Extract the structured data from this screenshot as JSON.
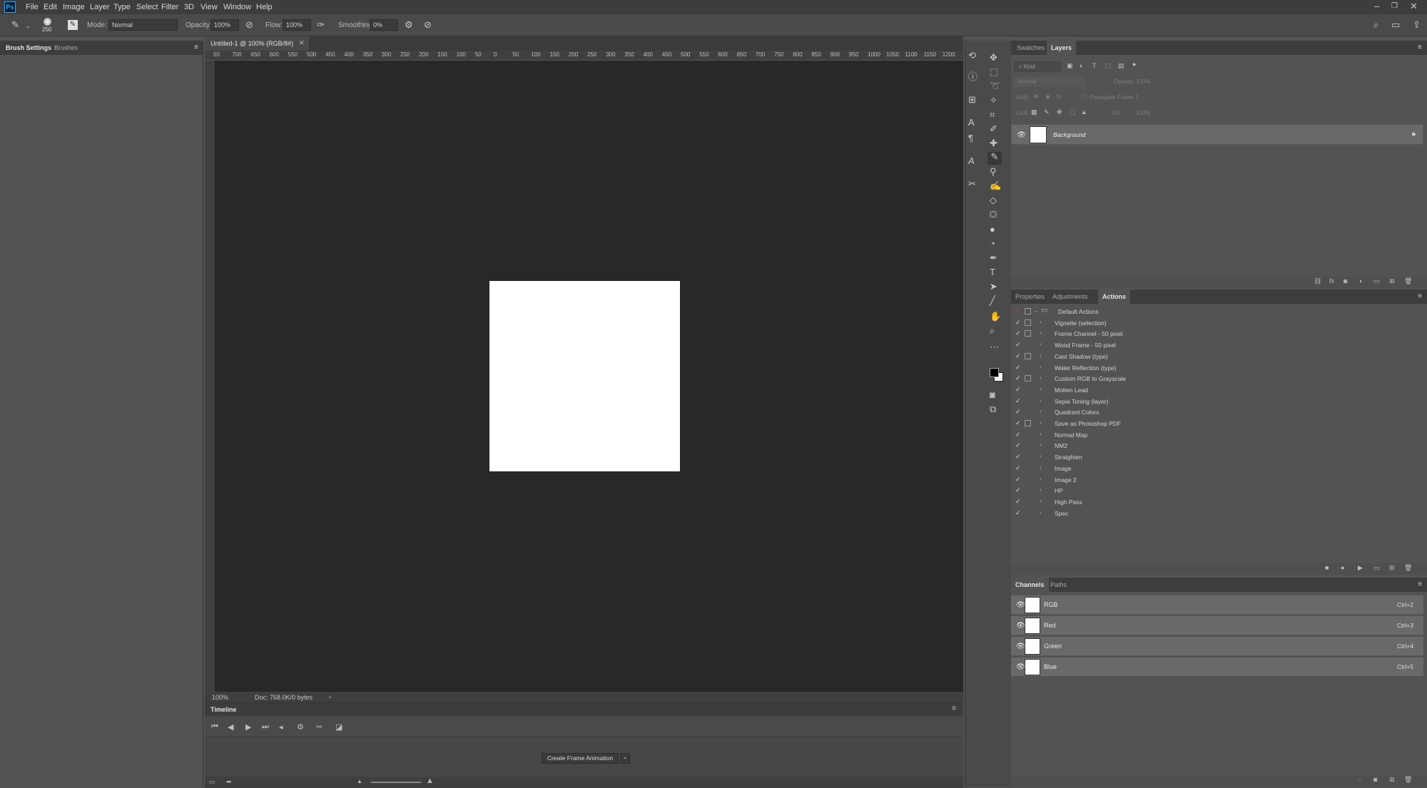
{
  "menu": [
    "File",
    "Edit",
    "Image",
    "Layer",
    "Type",
    "Select",
    "Filter",
    "3D",
    "View",
    "Window",
    "Help"
  ],
  "options": {
    "brush_size": "250",
    "mode_label": "Mode:",
    "mode_value": "Normal",
    "opacity_label": "Opacity:",
    "opacity_value": "100%",
    "flow_label": "Flow:",
    "flow_value": "100%",
    "smoothing_label": "Smoothing:",
    "smoothing_value": "0%"
  },
  "left_panel": {
    "tabs": [
      "Brush Settings",
      "Brushes"
    ]
  },
  "document": {
    "tab_title": "Untitled-1 @ 100% (RGB/8#)",
    "zoom": "100%",
    "doc_info": "Doc: 768.0K/0 bytes",
    "ruler_ticks": [
      "50",
      "700",
      "650",
      "600",
      "550",
      "500",
      "450",
      "400",
      "350",
      "300",
      "250",
      "200",
      "150",
      "100",
      "50",
      "0",
      "50",
      "100",
      "150",
      "200",
      "250",
      "300",
      "350",
      "400",
      "450",
      "500",
      "550",
      "600",
      "650",
      "700",
      "750",
      "800",
      "850",
      "900",
      "950",
      "1000",
      "1050",
      "1100",
      "1150",
      "1200"
    ]
  },
  "timeline": {
    "title": "Timeline",
    "create_button": "Create Frame Animation"
  },
  "layers_panel": {
    "tabs": [
      "Swatches",
      "Layers"
    ],
    "kind_placeholder": "Kind",
    "blend_mode": "Normal",
    "opacity_label": "Opacity:",
    "opacity_value": "100%",
    "unify_label": "Unify:",
    "propagate_label": "Propagate Frame 1",
    "lock_label": "Lock:",
    "fill_label": "Fill:",
    "fill_value": "100%",
    "layer_name": "Background"
  },
  "actions_panel": {
    "tabs": [
      "Properties",
      "Adjustments",
      "Actions"
    ],
    "set_name": "Default Actions",
    "items": [
      "Vignette (selection)",
      "Frame Channel - 50 pixel",
      "Wood Frame - 50 pixel",
      "Cast Shadow (type)",
      "Water Reflection (type)",
      "Custom RGB to Grayscale",
      "Molten Lead",
      "Sepia Toning (layer)",
      "Quadrant Colors",
      "Save as Photoshop PDF",
      "Normal Map",
      "NM2",
      "Straighten",
      "Image",
      "Image 2",
      "HP",
      "High Pass",
      "Spec"
    ],
    "dialog_flags": [
      true,
      true,
      false,
      true,
      false,
      true,
      false,
      false,
      false,
      true,
      false,
      false,
      false,
      false,
      false,
      false,
      false,
      false
    ]
  },
  "channels_panel": {
    "tabs": [
      "Channels",
      "Paths"
    ],
    "channels": [
      {
        "name": "RGB",
        "shortcut": "Ctrl+2"
      },
      {
        "name": "Red",
        "shortcut": "Ctrl+3"
      },
      {
        "name": "Green",
        "shortcut": "Ctrl+4"
      },
      {
        "name": "Blue",
        "shortcut": "Ctrl+5"
      }
    ]
  },
  "colors": {
    "canvas": "#ffffff",
    "pasteboard": "#282828",
    "panel": "#535353",
    "ps_logo": "#31a8ff"
  }
}
